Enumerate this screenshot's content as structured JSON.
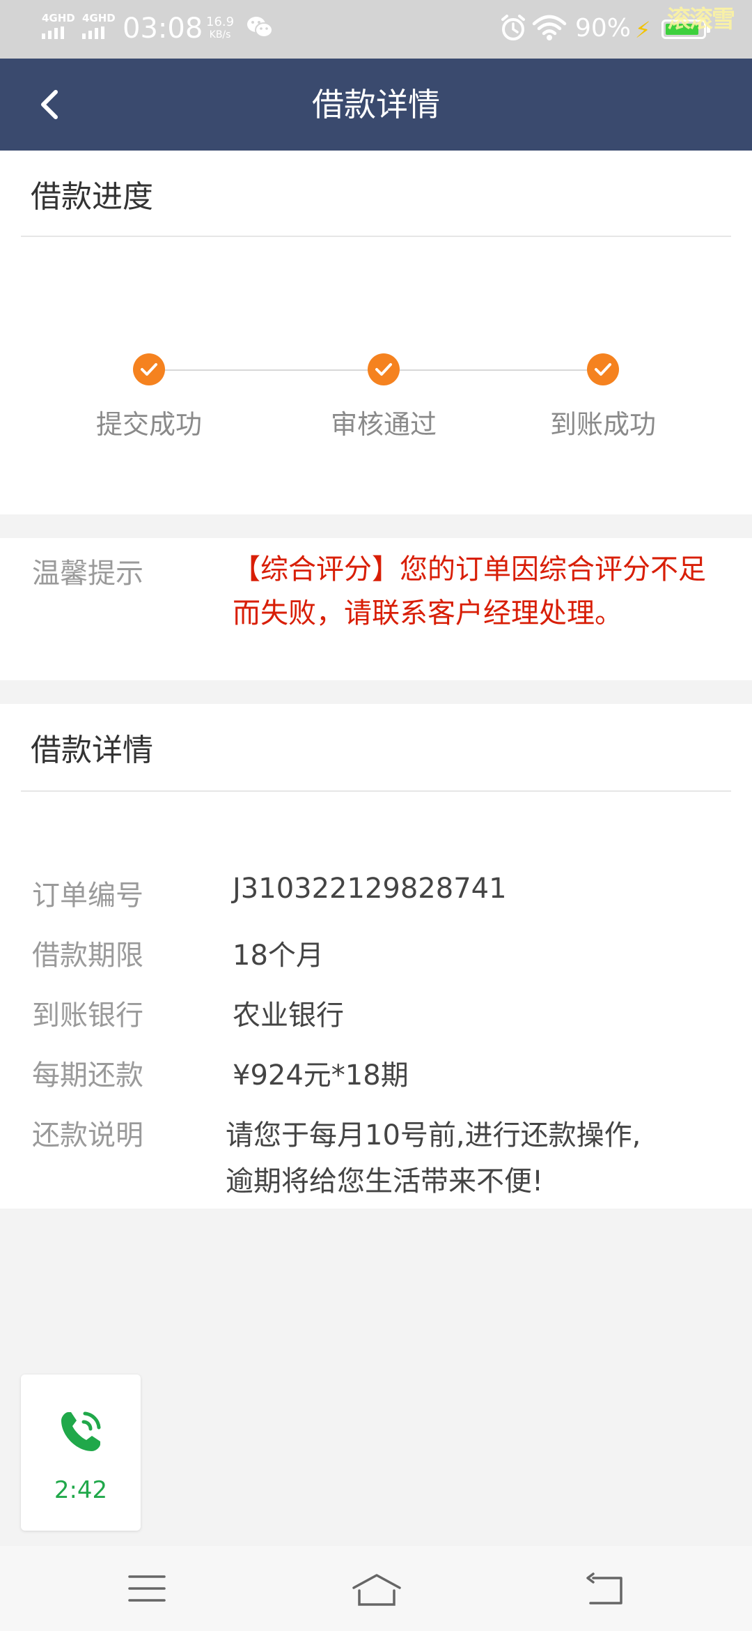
{
  "status_bar": {
    "network1": "4GHD",
    "network2": "4GHD",
    "time": "03:08",
    "speed_value": "16.9",
    "speed_unit": "KB/s",
    "battery": "90%",
    "battery_level": 0.9,
    "watermark": "滚滚雪",
    "battery_color": "#3dd03d"
  },
  "nav": {
    "title": "借款详情",
    "back_icon": "chevron-left-icon",
    "color": "#3a4a6e"
  },
  "progress": {
    "title": "借款进度",
    "steps": [
      {
        "label": "提交成功",
        "done": true
      },
      {
        "label": "审核通过",
        "done": true
      },
      {
        "label": "到账成功",
        "done": true
      }
    ],
    "accent": "#f5821f"
  },
  "tip": {
    "label": "温馨提示",
    "text": "【综合评分】您的订单因综合评分不足而失败，请联系客户经理处理。",
    "color": "#d81e06"
  },
  "details": {
    "title": "借款详情",
    "rows": [
      {
        "label": "订单编号",
        "value": "J310322129828741"
      },
      {
        "label": "借款期限",
        "value": "18个月"
      },
      {
        "label": "到账银行",
        "value": "农业银行"
      },
      {
        "label": "每期还款",
        "value": "¥924元*18期"
      },
      {
        "label": "还款说明",
        "value_line1": "请您于每月10号前,进行还款操作,",
        "value_line2": "逾期将给您生活带来不便!"
      }
    ]
  },
  "call": {
    "icon": "phone-call-icon",
    "duration": "2:42",
    "color": "#20a84a"
  },
  "bottom_nav": {
    "icons": [
      "menu-icon",
      "home-icon",
      "back-icon"
    ]
  }
}
